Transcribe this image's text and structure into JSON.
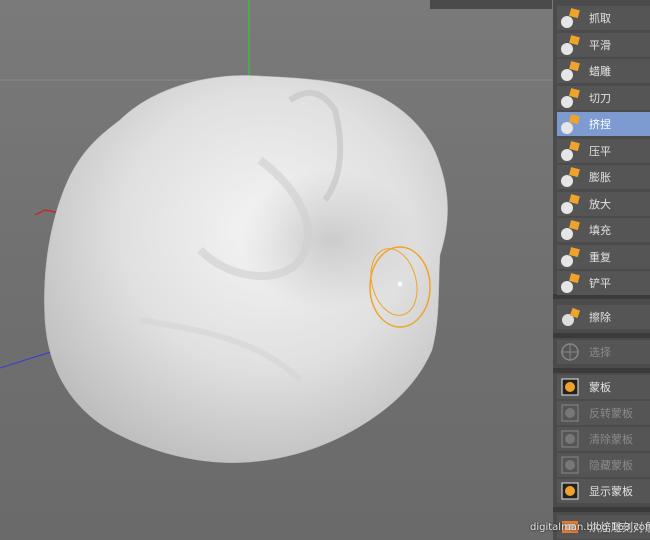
{
  "viewport": {
    "top_readout": "",
    "axis_colors": {
      "y": "#2fd12f",
      "x": "#c42a2a",
      "z": "#3a3ad6"
    },
    "brush_color": "#f0a32a"
  },
  "palette": {
    "group1": [
      {
        "label": "抓取",
        "icon": "grab-brush-icon"
      },
      {
        "label": "平滑",
        "icon": "smooth-brush-icon"
      },
      {
        "label": "蜡雕",
        "icon": "wax-brush-icon"
      },
      {
        "label": "切刀",
        "icon": "knife-brush-icon"
      },
      {
        "label": "挤捏",
        "icon": "pinch-brush-icon",
        "active": true
      },
      {
        "label": "压平",
        "icon": "flatten-brush-icon"
      },
      {
        "label": "膨胀",
        "icon": "inflate-brush-icon"
      },
      {
        "label": "放大",
        "icon": "magnify-brush-icon"
      },
      {
        "label": "填充",
        "icon": "fill-brush-icon"
      },
      {
        "label": "重复",
        "icon": "repeat-brush-icon"
      },
      {
        "label": "铲平",
        "icon": "scrape-brush-icon"
      }
    ],
    "erase": {
      "label": "擦除",
      "icon": "erase-brush-icon"
    },
    "select": {
      "label": "选择",
      "icon": "select-brush-icon"
    },
    "mask_group": [
      {
        "label": "蒙板",
        "icon": "mask-brush-icon",
        "disabled": false
      },
      {
        "label": "反转蒙板",
        "icon": "invert-mask-icon",
        "disabled": true
      },
      {
        "label": "清除蒙板",
        "icon": "clear-mask-icon",
        "disabled": true
      },
      {
        "label": "隐藏蒙板",
        "icon": "hide-mask-icon",
        "disabled": true
      },
      {
        "label": "显示蒙板",
        "icon": "show-mask-icon",
        "disabled": false
      }
    ],
    "bake": {
      "label": "烘焙雕刻对象",
      "icon": "bake-sculpt-icon"
    }
  },
  "watermark": "digitalman.blog.163.com"
}
